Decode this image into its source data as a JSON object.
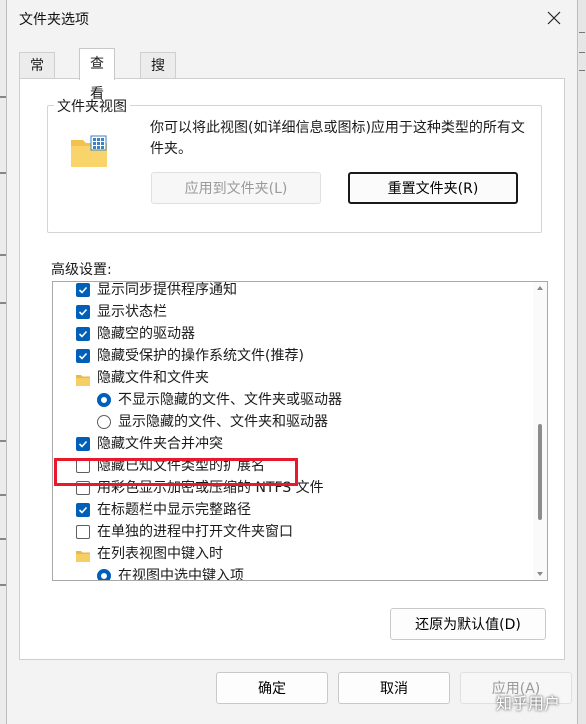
{
  "window": {
    "title": "文件夹选项"
  },
  "tabs": [
    {
      "label": "常规",
      "active": false
    },
    {
      "label": "查看",
      "active": true
    },
    {
      "label": "搜索",
      "active": false
    }
  ],
  "folder_view": {
    "legend": "文件夹视图",
    "description": "你可以将此视图(如详细信息或图标)应用于这种类型的所有文件夹。",
    "apply_button": "应用到文件夹(L)",
    "reset_button": "重置文件夹(R)"
  },
  "advanced": {
    "label": "高级设置:",
    "items": [
      {
        "type": "checkbox",
        "checked": true,
        "level": 1,
        "label": "显示同步提供程序通知"
      },
      {
        "type": "checkbox",
        "checked": true,
        "level": 1,
        "label": "显示状态栏"
      },
      {
        "type": "checkbox",
        "checked": true,
        "level": 1,
        "label": "隐藏空的驱动器"
      },
      {
        "type": "checkbox",
        "checked": true,
        "level": 1,
        "label": "隐藏受保护的操作系统文件(推荐)"
      },
      {
        "type": "folder",
        "level": 1,
        "label": "隐藏文件和文件夹"
      },
      {
        "type": "radio",
        "checked": true,
        "level": 2,
        "label": "不显示隐藏的文件、文件夹或驱动器"
      },
      {
        "type": "radio",
        "checked": false,
        "level": 2,
        "label": "显示隐藏的文件、文件夹和驱动器"
      },
      {
        "type": "checkbox",
        "checked": true,
        "level": 1,
        "label": "隐藏文件夹合并冲突"
      },
      {
        "type": "checkbox",
        "checked": false,
        "level": 1,
        "label": "隐藏已知文件类型的扩展名"
      },
      {
        "type": "checkbox",
        "checked": false,
        "level": 1,
        "label": "用彩色显示加密或压缩的 NTFS 文件"
      },
      {
        "type": "checkbox",
        "checked": true,
        "level": 1,
        "label": "在标题栏中显示完整路径"
      },
      {
        "type": "checkbox",
        "checked": false,
        "level": 1,
        "label": "在单独的进程中打开文件夹窗口"
      },
      {
        "type": "folder",
        "level": 1,
        "label": "在列表视图中键入时"
      },
      {
        "type": "radio",
        "checked": true,
        "level": 2,
        "label": "在视图中选中键入项"
      }
    ],
    "restore_button": "还原为默认值(D)"
  },
  "footer": {
    "ok": "确定",
    "cancel": "取消",
    "apply": "应用(A)"
  },
  "watermark": "知乎用户",
  "colors": {
    "accent": "#005fb8",
    "highlight": "#e8192c"
  }
}
